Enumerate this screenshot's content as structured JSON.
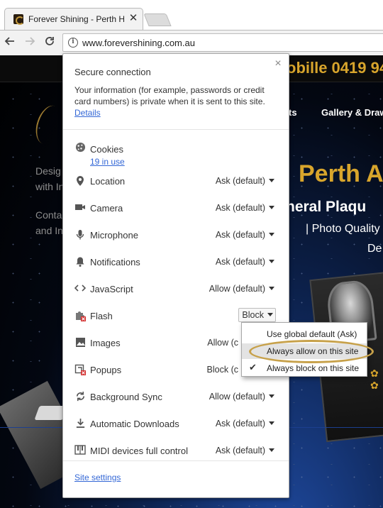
{
  "browser": {
    "tab_title": "Forever Shining - Perth H",
    "tab_close_glyph": "✕",
    "url": "www.forevershining.com.au",
    "icons": [
      "back-arrow-icon",
      "forward-arrow-icon",
      "reload-icon",
      "info-icon"
    ]
  },
  "website": {
    "mobile_text": "obille 0419 94",
    "nav_links": [
      "ts",
      "Gallery & Draw"
    ],
    "side_text": [
      "Desig",
      "with In",
      "Conta",
      "and In"
    ],
    "headline": "Perth A",
    "subheadline_1": "neral Plaqu",
    "subheadline_2": "| Photo Quality",
    "subheadline_3": "De"
  },
  "site_info": {
    "title": "Secure connection",
    "description": "Your information (for example, passwords or credit card numbers) is private when it is sent to this site.",
    "details_link": "Details",
    "close_glyph": "×",
    "cookies": {
      "label": "Cookies",
      "count_link": "19 in use",
      "icon": "cookie-icon"
    },
    "permissions": [
      {
        "label": "Location",
        "value": "Ask (default)",
        "icon": "location-pin-icon"
      },
      {
        "label": "Camera",
        "value": "Ask (default)",
        "icon": "camera-icon"
      },
      {
        "label": "Microphone",
        "value": "Ask (default)",
        "icon": "microphone-icon"
      },
      {
        "label": "Notifications",
        "value": "Ask (default)",
        "icon": "bell-icon"
      },
      {
        "label": "JavaScript",
        "value": "Allow (default)",
        "icon": "code-icon"
      },
      {
        "label": "Flash",
        "value": "Block",
        "icon": "puzzle-blocked-icon"
      },
      {
        "label": "Images",
        "value": "Allow (c",
        "icon": "image-icon"
      },
      {
        "label": "Popups",
        "value": "Block (c",
        "icon": "popup-blocked-icon"
      },
      {
        "label": "Background Sync",
        "value": "Allow (default)",
        "icon": "sync-icon"
      },
      {
        "label": "Automatic Downloads",
        "value": "Ask (default)",
        "icon": "download-icon"
      },
      {
        "label": "MIDI devices full control",
        "value": "Ask (default)",
        "icon": "piano-icon"
      }
    ],
    "site_settings_link": "Site settings"
  },
  "flash_dropdown": {
    "options": [
      "Use global default (Ask)",
      "Always allow on this site",
      "Always block on this site"
    ],
    "hovered": "Always allow on this site",
    "checked": "Always block on this site",
    "check_glyph": "✔"
  },
  "colors": {
    "link": "#3367d6",
    "accent_gold": "#d8a52c",
    "highlight_ring": "#c7a14a"
  }
}
